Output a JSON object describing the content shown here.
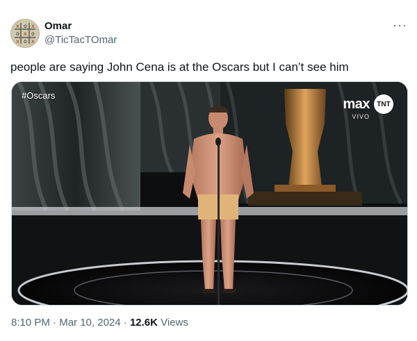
{
  "author": {
    "name": "Omar",
    "handle": "@TicTacTOmar",
    "avatar": "tic-tac-toe-grid-avatar"
  },
  "tweet": {
    "text": "people are saying John Cena is at the Oscars but I can’t see him",
    "more_label": "···"
  },
  "media": {
    "hashtag": "#Oscars",
    "network_logo": "max",
    "channel_logo": "TNT",
    "live_label": "VIVO"
  },
  "meta": {
    "time": "8:10 PM",
    "date": "Mar 10, 2024",
    "separator": " · ",
    "views_count": "12.6K",
    "views_label": "Views"
  },
  "colors": {
    "text": "#0f1419",
    "secondary": "#536471",
    "border": "#cfd9de"
  }
}
